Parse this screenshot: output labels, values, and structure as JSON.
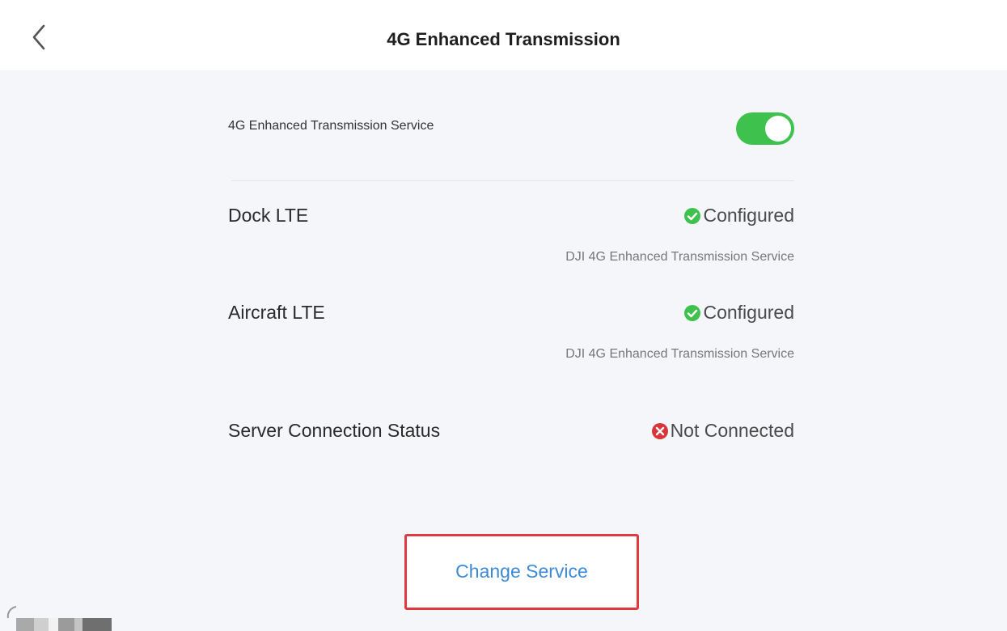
{
  "header": {
    "title": "4G Enhanced Transmission",
    "back_icon": "chevron-left-icon"
  },
  "service": {
    "label": "4G Enhanced Transmission Service",
    "toggle_on": true,
    "toggle_color": "#3ec24d"
  },
  "statuses": [
    {
      "label": "Dock LTE",
      "value": "Configured",
      "state": "ok",
      "sub": "DJI 4G Enhanced Transmission Service"
    },
    {
      "label": "Aircraft LTE",
      "value": "Configured",
      "state": "ok",
      "sub": "DJI 4G Enhanced Transmission Service"
    },
    {
      "label": "Server Connection Status",
      "value": "Not Connected",
      "state": "error",
      "sub": ""
    }
  ],
  "colors": {
    "ok": "#3ec24d",
    "error": "#d9363b",
    "link": "#3c8ad6",
    "highlight_border": "#e03a3e"
  },
  "actions": {
    "change_service_label": "Change Service"
  }
}
